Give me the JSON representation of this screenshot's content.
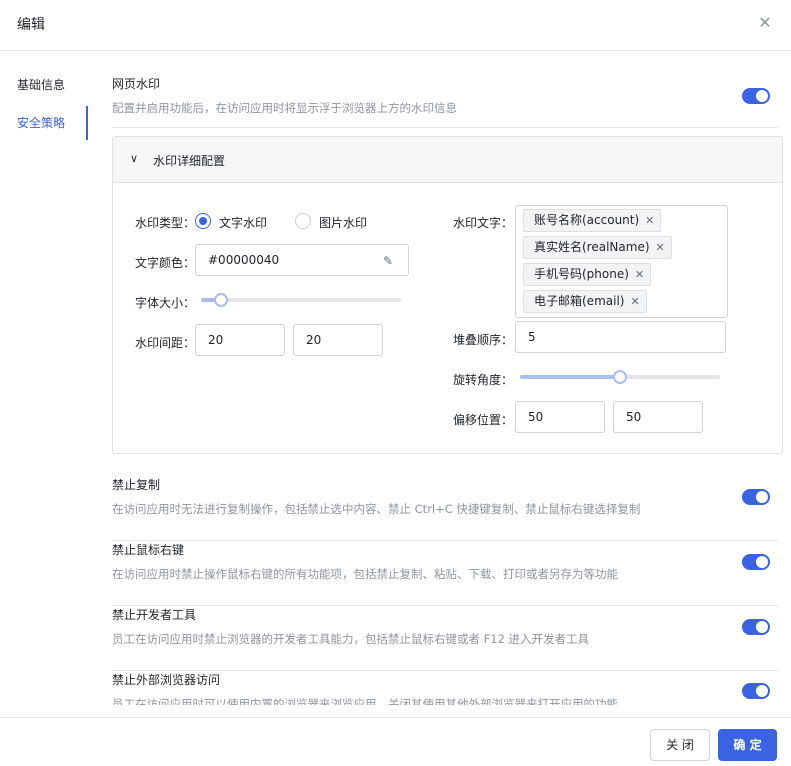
{
  "dialog": {
    "title": "编辑",
    "close_icon": "close-icon"
  },
  "sidenav": {
    "items": [
      {
        "label": "基础信息"
      },
      {
        "label": "安全策略",
        "active": true
      }
    ]
  },
  "watermark": {
    "title": "网页水印",
    "desc": "配置并启用功能后，在访问应用时将显示浮于浏览器上方的水印信息",
    "enabled": true,
    "panel_title": "水印详细配置",
    "type_label": "水印类型：",
    "type_options": [
      {
        "label": "文字水印",
        "checked": true
      },
      {
        "label": "图片水印",
        "checked": false
      }
    ],
    "color_label": "文字颜色：",
    "color_value": "#00000040",
    "font_size_label": "字体大小：",
    "font_size_level": 0.1,
    "spacing_label": "水印间距：",
    "spacing_x": "20",
    "spacing_y": "20",
    "text_label": "水印文字：",
    "text_tags": [
      "账号名称(account)",
      "真实姓名(realName)",
      "手机号码(phone)",
      "电子邮箱(email)"
    ],
    "zindex_label": "堆叠顺序：",
    "zindex_value": "5",
    "rotate_label": "旋转角度：",
    "rotate_level": 0.5,
    "offset_label": "偏移位置：",
    "offset_x": "50",
    "offset_y": "50"
  },
  "policies": [
    {
      "title": "禁止复制",
      "desc": "在访问应用时无法进行复制操作，包括禁止选中内容、禁止 Ctrl+C 快捷键复制、禁止鼠标右键选择复制",
      "enabled": true
    },
    {
      "title": "禁止鼠标右键",
      "desc": "在访问应用时禁止操作鼠标右键的所有功能项，包括禁止复制、粘贴、下载、打印或者另存为等功能",
      "enabled": true
    },
    {
      "title": "禁止开发者工具",
      "desc": "员工在访问应用时禁止浏览器的开发者工具能力，包括禁止鼠标右键或者 F12 进入开发者工具",
      "enabled": true
    },
    {
      "title": "禁止外部浏览器访问",
      "desc": "员工在访问应用时可以使用内置的浏览器来浏览应用，关闭其使用其他外部浏览器来打开应用的功能",
      "enabled": true
    }
  ],
  "footer": {
    "cancel_label": "关 闭",
    "confirm_label": "确 定"
  },
  "colors": {
    "accent": "#3a63e4"
  }
}
